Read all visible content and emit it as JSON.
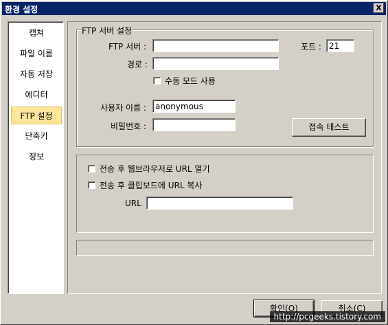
{
  "window": {
    "title": "환경 설정",
    "close_label": "X"
  },
  "sidebar": {
    "items": [
      {
        "label": "캡쳐"
      },
      {
        "label": "파일 이름"
      },
      {
        "label": "자동 저장"
      },
      {
        "label": "에디터"
      },
      {
        "label": "FTP 설정"
      },
      {
        "label": "단축키"
      },
      {
        "label": "정보"
      }
    ],
    "active": "FTP 설정"
  },
  "ftp": {
    "group_title": "FTP 서버 설정",
    "server_label": "FTP 서버 :",
    "server_value": "",
    "port_label": "포트 :",
    "port_value": "21",
    "path_label": "경로 :",
    "path_value": "",
    "passive_label": "수동 모드 사용",
    "user_label": "사용자 이름 :",
    "user_value": "anonymous",
    "password_label": "비밀번호 :",
    "password_value": "",
    "test_button": "접속 테스트"
  },
  "after_transfer": {
    "open_browser_label": "전송 후 웹브라우저로 URL 열기",
    "copy_clipboard_label": "전송 후 클립보드에 URL 복사",
    "url_label": "URL",
    "url_value": ""
  },
  "footer": {
    "ok_button": "확인(O)",
    "cancel_button": "취소(C)"
  },
  "watermark": "http://pcgeeks.tistory.com"
}
